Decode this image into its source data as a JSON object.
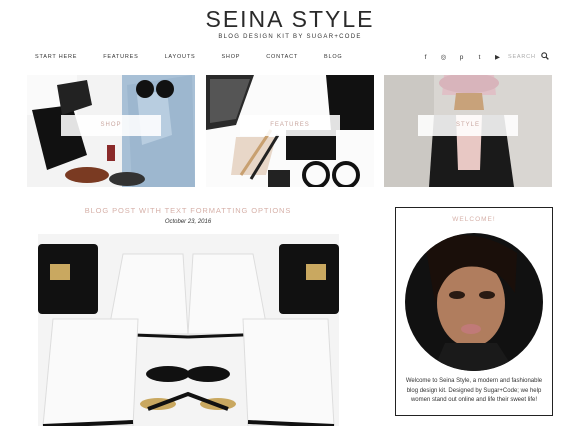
{
  "header": {
    "title": "SEINA STYLE",
    "tagline": "BLOG DESIGN KIT BY SUGAR+CODE"
  },
  "nav": {
    "items": [
      "START HERE",
      "FEATURES",
      "LAYOUTS",
      "SHOP",
      "CONTACT",
      "BLOG"
    ]
  },
  "social": {
    "icons": [
      {
        "name": "facebook-icon",
        "glyph": "f"
      },
      {
        "name": "instagram-icon",
        "glyph": "◎"
      },
      {
        "name": "pinterest-icon",
        "glyph": "p"
      },
      {
        "name": "twitter-icon",
        "glyph": "t"
      },
      {
        "name": "youtube-icon",
        "glyph": "▶"
      }
    ]
  },
  "search": {
    "placeholder": "SEARCH",
    "icon": "search-icon"
  },
  "tiles": [
    {
      "label": "SHOP"
    },
    {
      "label": "FEATURES"
    },
    {
      "label": "STYLE"
    }
  ],
  "post": {
    "title": "BLOG POST WITH TEXT FORMATTING OPTIONS",
    "date": "October 23, 2016"
  },
  "widget": {
    "title": "WELCOME!",
    "text": "Welcome to Seina Style, a modern and fashionable blog design kit. Designed by Sugar+Code; we help women stand out online and life their sweet life!"
  },
  "colors": {
    "accent": "#d6b0a8",
    "text": "#222222",
    "background": "#ffffff"
  }
}
